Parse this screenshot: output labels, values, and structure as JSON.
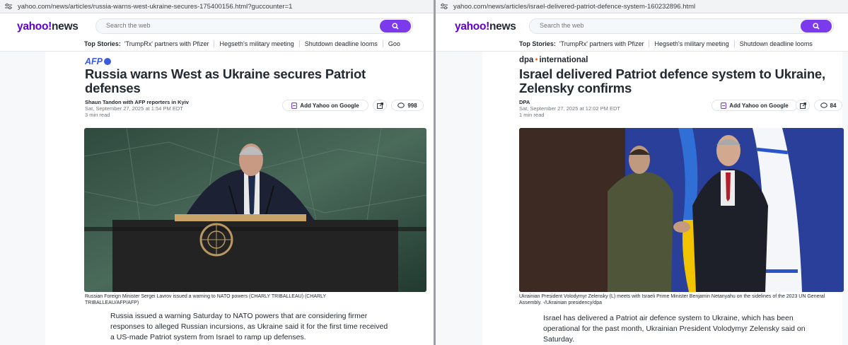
{
  "left": {
    "url": "yahoo.com/news/articles/russia-warns-west-ukraine-secures-175400156.html?guccounter=1",
    "logo": {
      "yahoo": "yahoo!",
      "news": "news"
    },
    "search_placeholder": "Search the web",
    "top_stories_label": "Top Stories:",
    "top_stories": [
      "'TrumpRx' partners with Pfizer",
      "Hegseth's military meeting",
      "Shutdown deadline looms",
      "Goo"
    ],
    "source": "AFP",
    "headline": "Russia warns West as Ukraine secures Patriot defenses",
    "byline": "Shaun Tandon with AFP reporters in Kyiv",
    "date": "Sat, September 27, 2025 at 1:54 PM EDT",
    "read_time": "3 min read",
    "add_yahoo_label": "Add Yahoo on Google",
    "comment_count": "998",
    "caption": "Russian Foreign Minister Sergei Lavrov issued a warning to NATO powers (CHARLY TRIBALLEAU) (CHARLY TRIBALLEAU/AFP/AFP)",
    "body": "Russia issued a warning Saturday to NATO powers that are considering firmer responses to alleged Russian incursions, as Ukraine said it for the first time received a US-made Patriot system from Israel to ramp up defenses."
  },
  "right": {
    "url": "yahoo.com/news/articles/israel-delivered-patriot-defence-system-160232896.html",
    "logo": {
      "yahoo": "yahoo!",
      "news": "news"
    },
    "search_placeholder": "Search the web",
    "top_stories_label": "Top Stories:",
    "top_stories": [
      "'TrumpRx' partners with Pfizer",
      "Hegseth's military meeting",
      "Shutdown deadline looms"
    ],
    "source_dpa": "dpa",
    "source_international": "international",
    "headline": "Israel delivered Patriot defence system to Ukraine, Zelensky confirms",
    "byline": "DPA",
    "date": "Sat, September 27, 2025 at 12:02 PM EDT",
    "read_time": "1 min read",
    "add_yahoo_label": "Add Yahoo on Google",
    "comment_count": "84",
    "caption": "Ukrainian President Volodymyr Zelensky (L) meets with Israeli Prime Minister Benjamin Netanyahu on the sidelines of the 2023 UN General Assembly. -/Ukrainian presidency/dpa",
    "body": "Israel has delivered a Patriot air defence system to Ukraine, which has been operational for the past month, Ukrainian President Volodymyr Zelensky said on Saturday."
  },
  "colors": {
    "yahoo_purple": "#6001d2",
    "search_button": "#7c3aed",
    "afp_blue": "#3b5bdb",
    "dpa_orange": "#ff6a00"
  },
  "icons": [
    "site-settings-icon",
    "search-icon",
    "google-add-icon",
    "share-icon",
    "comment-icon"
  ]
}
